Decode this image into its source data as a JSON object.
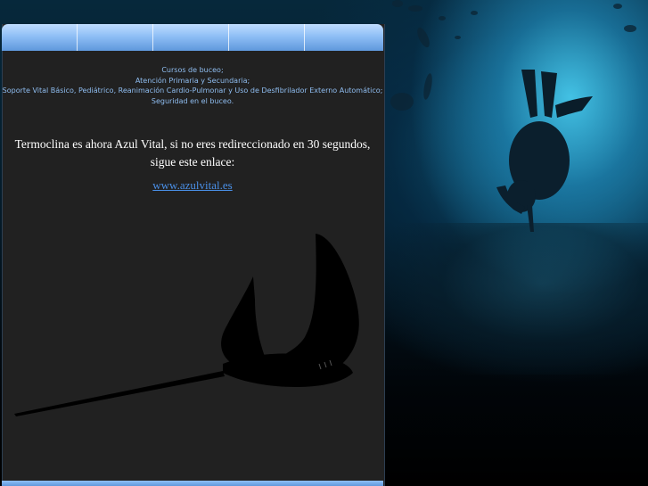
{
  "nav": {
    "tabs": [
      {
        "label": ""
      },
      {
        "label": ""
      },
      {
        "label": ""
      },
      {
        "label": ""
      },
      {
        "label": ""
      }
    ]
  },
  "topics": {
    "line1": "Cursos de buceo;",
    "line2": "Atención Primaria y Secundaria;",
    "line3": "Soporte Vital Básico, Pediátrico, Reanimación Cardio-Pulmonar y Uso de Desfibrilador Externo Automático;",
    "line4": "Seguridad en el buceo."
  },
  "message": "Termoclina es ahora Azul Vital, si no eres redireccionado en 30 segundos, sigue este enlace:",
  "link": {
    "text": "www.azulvital.es"
  },
  "colors": {
    "panel_bg": "#212121",
    "topic_text": "#8fbdf0",
    "link": "#4a90e8",
    "nav_gradient_top": "#bfdcff",
    "nav_gradient_bottom": "#5f98dc"
  },
  "icons": {
    "ray": "manta-ray-silhouette",
    "diver": "scuba-diver-silhouette"
  }
}
